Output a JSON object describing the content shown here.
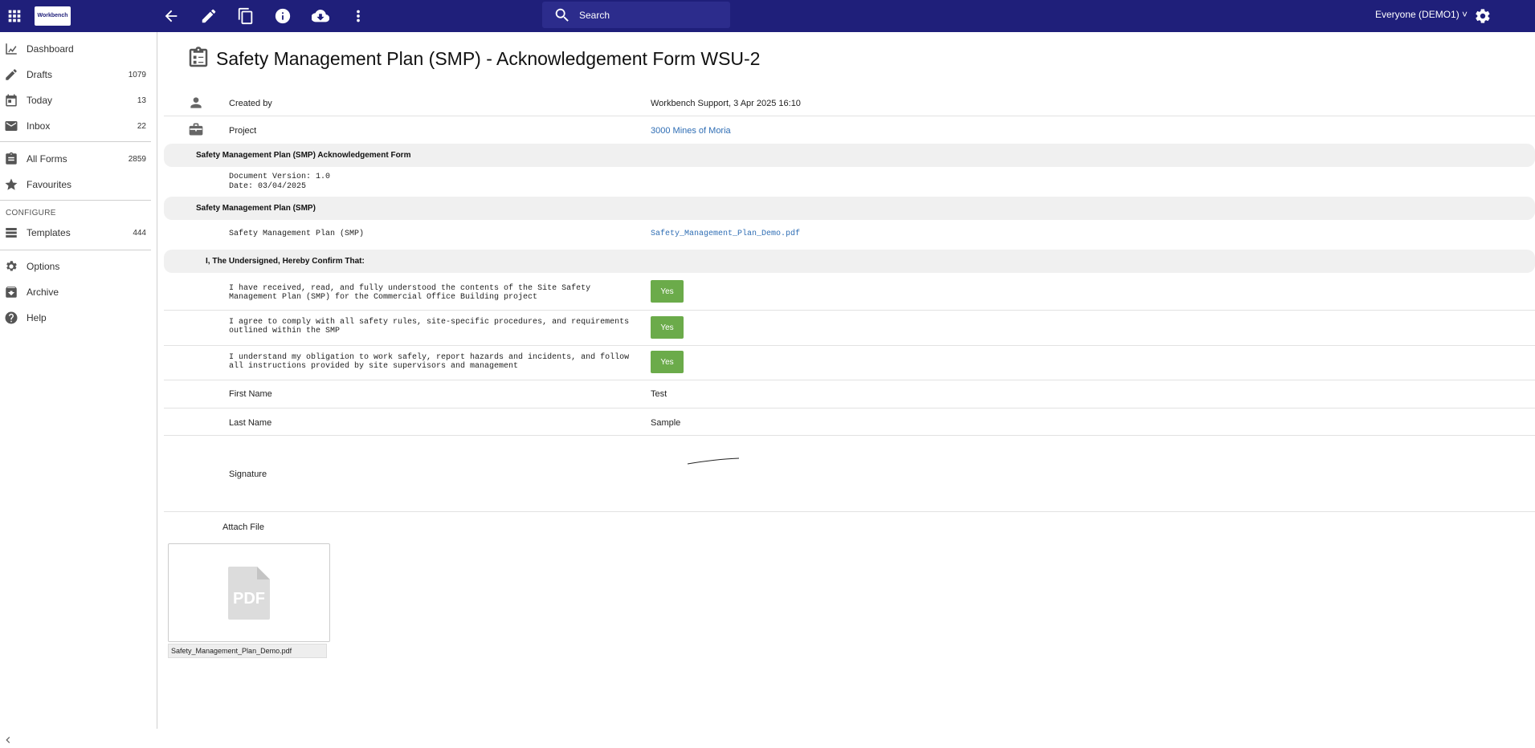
{
  "topbar": {
    "logo_text": "Workbench",
    "search_placeholder": "Search",
    "user_label": "Everyone (DEMO1) ˅"
  },
  "sidebar": {
    "items": [
      {
        "label": "Dashboard",
        "count": "",
        "icon": "dashboard-icon"
      },
      {
        "label": "Drafts",
        "count": "1079",
        "icon": "pencil-icon"
      },
      {
        "label": "Today",
        "count": "13",
        "icon": "calendar-icon"
      },
      {
        "label": "Inbox",
        "count": "22",
        "icon": "mail-icon"
      },
      {
        "label": "All Forms",
        "count": "2859",
        "icon": "clipboard-icon"
      },
      {
        "label": "Favourites",
        "count": "",
        "icon": "star-icon"
      },
      {
        "label": "Templates",
        "count": "444",
        "icon": "layers-icon"
      },
      {
        "label": "Options",
        "count": "",
        "icon": "gear-icon"
      },
      {
        "label": "Archive",
        "count": "",
        "icon": "archive-icon"
      },
      {
        "label": "Help",
        "count": "",
        "icon": "help-icon"
      }
    ],
    "configure_heading": "CONFIGURE"
  },
  "form": {
    "title": "Safety Management Plan (SMP) - Acknowledgement Form WSU-2",
    "created_by_label": "Created by",
    "created_by_value": "Workbench Support, 3 Apr 2025 16:10",
    "project_label": "Project",
    "project_value": "3000 Mines of Moria",
    "section1_title": "Safety Management Plan (SMP) Acknowledgement Form",
    "doc_version": "Document Version: 1.0",
    "doc_date": "Date: 03/04/2025",
    "section2_title": "Safety Management Plan (SMP)",
    "smp_label": "Safety Management Plan (SMP)",
    "smp_file": "Safety_Management_Plan_Demo.pdf",
    "section3_title": "I, The Undersigned, Hereby Confirm That:",
    "q1": "I have received, read, and fully understood the contents of the Site Safety Management Plan (SMP) for the Commercial Office Building project",
    "q2": "I agree to comply with all safety rules, site-specific procedures, and requirements outlined within the SMP",
    "q3": "I understand my obligation to work safely, report hazards and incidents, and follow all instructions provided by site supervisors and management",
    "answer_yes": "Yes",
    "first_name_label": "First Name",
    "first_name_value": "Test",
    "last_name_label": "Last Name",
    "last_name_value": "Sample",
    "signature_label": "Signature",
    "attach_label": "Attach File",
    "attach_badge": "PDF",
    "attach_name": "Safety_Management_Plan_Demo.pdf"
  },
  "colors": {
    "topbar": "#1f1f7a",
    "yes_button": "#6bab4a",
    "link": "#2e6db4"
  }
}
